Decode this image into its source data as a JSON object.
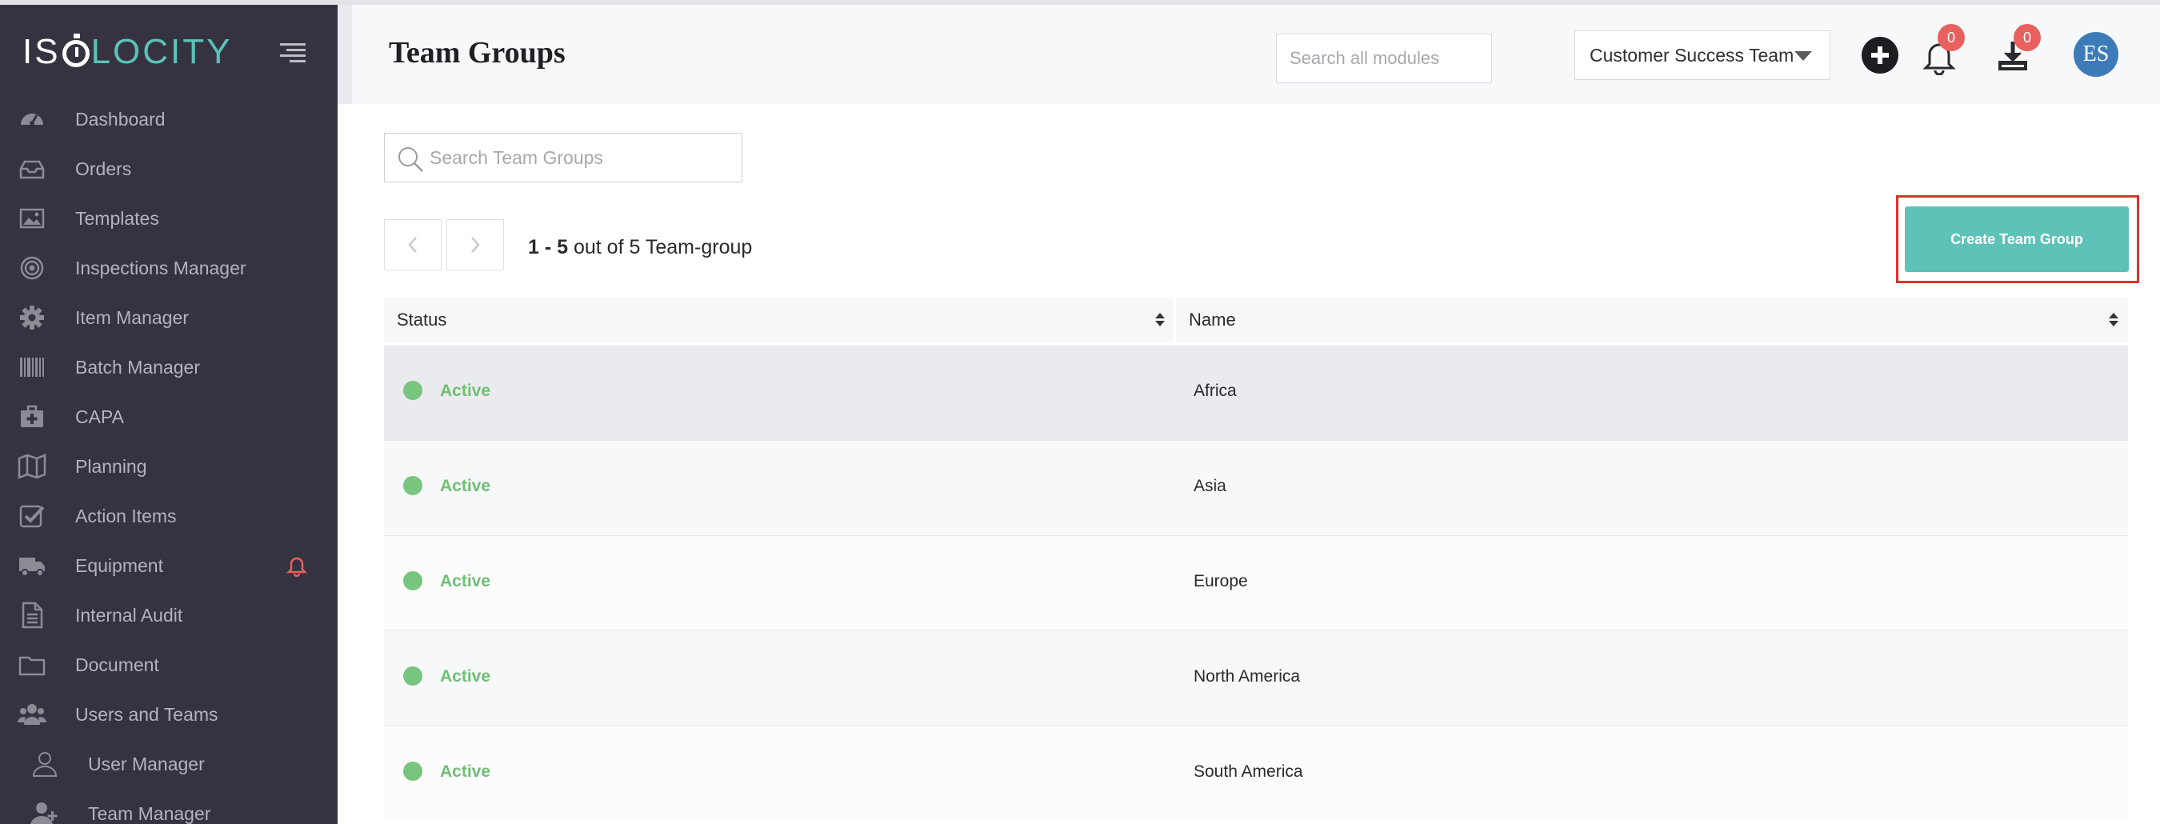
{
  "sidebar": {
    "logo": {
      "part1": "IS",
      "part2": "LOCITY"
    },
    "items": [
      {
        "label": "Dashboard",
        "icon": "dashboard-icon"
      },
      {
        "label": "Orders",
        "icon": "inbox-icon"
      },
      {
        "label": "Templates",
        "icon": "image-icon"
      },
      {
        "label": "Inspections Manager",
        "icon": "target-icon"
      },
      {
        "label": "Item Manager",
        "icon": "gear-icon"
      },
      {
        "label": "Batch Manager",
        "icon": "barcode-icon"
      },
      {
        "label": "CAPA",
        "icon": "medkit-icon"
      },
      {
        "label": "Planning",
        "icon": "map-icon"
      },
      {
        "label": "Action Items",
        "icon": "checkbox-icon"
      },
      {
        "label": "Equipment",
        "icon": "truck-icon"
      },
      {
        "label": "Internal Audit",
        "icon": "document-icon"
      },
      {
        "label": "Document",
        "icon": "folder-icon"
      },
      {
        "label": "Users and Teams",
        "icon": "users-icon"
      },
      {
        "label": "User Manager",
        "icon": "user-icon"
      },
      {
        "label": "Team Manager",
        "icon": "user-plus-icon"
      }
    ]
  },
  "header": {
    "title": "Team Groups",
    "search_placeholder": "Search all modules",
    "team_select": "Customer Success Team",
    "notifications_count": "0",
    "downloads_count": "0",
    "avatar_initials": "ES"
  },
  "main": {
    "search_placeholder": "Search Team Groups",
    "pager": {
      "range": "1 - 5",
      "suffix": "out of 5 Team-group"
    },
    "create_button": "Create Team Group",
    "table": {
      "columns": [
        "Status",
        "Name"
      ],
      "rows": [
        {
          "status": "Active",
          "name": "Africa"
        },
        {
          "status": "Active",
          "name": "Asia"
        },
        {
          "status": "Active",
          "name": "Europe"
        },
        {
          "status": "Active",
          "name": "North America"
        },
        {
          "status": "Active",
          "name": "South America"
        }
      ]
    }
  },
  "colors": {
    "sidebar_bg": "#363341",
    "accent": "#5ec2b8",
    "active_status": "#6fbf74",
    "badge": "#e8615f",
    "avatar": "#3d7bb8",
    "highlight_outline": "#e0312b"
  }
}
